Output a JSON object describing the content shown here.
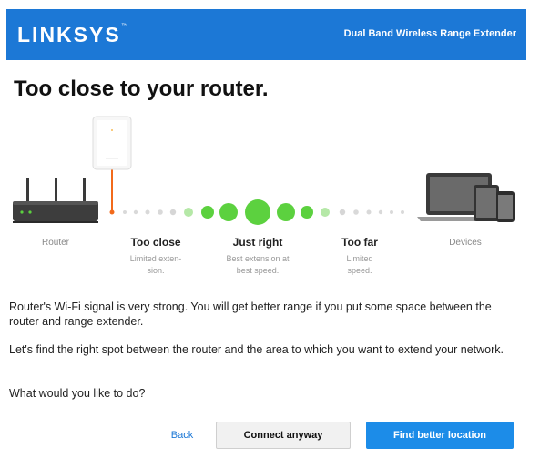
{
  "header": {
    "logo": "LINKSYS",
    "logo_tm": "™",
    "product": "Dual Band Wireless Range Extender"
  },
  "title": "Too close to your router.",
  "diagram": {
    "router_label": "Router",
    "devices_label": "Devices",
    "zones": [
      {
        "name": "Too close",
        "desc_line1": "Limited exten-",
        "desc_line2": "sion."
      },
      {
        "name": "Just right",
        "desc_line1": "Best extension at",
        "desc_line2": "best speed."
      },
      {
        "name": "Too far",
        "desc_line1": "Limited",
        "desc_line2": "speed."
      }
    ],
    "colors": {
      "green": "#5cd13f",
      "grey_dot": "#d9d9d9",
      "line_orange": "#f26a1b"
    }
  },
  "body": {
    "p1": "Router's Wi-Fi signal is very strong. You will get better range if you put some space between the router and range extender.",
    "p2": "Let's find the right spot between the router and the area to which you want to extend your network.",
    "p3": "What would you like to do?"
  },
  "buttons": {
    "back": "Back",
    "connect": "Connect anyway",
    "find": "Find better location"
  }
}
